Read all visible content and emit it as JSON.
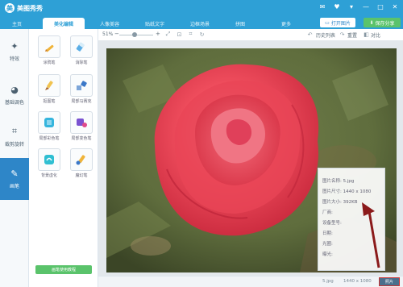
{
  "app": {
    "title": "美图秀秀"
  },
  "tabs": [
    {
      "label": "主页"
    },
    {
      "label": "美化编辑"
    },
    {
      "label": "人像美容"
    },
    {
      "label": "贴纸文字"
    },
    {
      "label": "边框场景"
    },
    {
      "label": "拼图"
    },
    {
      "label": "更多"
    }
  ],
  "actions": {
    "open": "打开图片",
    "share": "保存分享"
  },
  "sidebar": [
    {
      "label": "特效"
    },
    {
      "label": "基础调色"
    },
    {
      "label": "裁剪旋转"
    },
    {
      "label": "画笔"
    }
  ],
  "tools": [
    {
      "label": "涂鸦笔"
    },
    {
      "label": "消除笔"
    },
    {
      "label": "抠图笔"
    },
    {
      "label": "局部马赛克"
    },
    {
      "label": "局部彩色笔"
    },
    {
      "label": "局部变色笔"
    },
    {
      "label": "背景虚化"
    },
    {
      "label": "魔幻笔"
    }
  ],
  "tutorial": "画笔使用教程",
  "toolbar": {
    "zoom": "51%",
    "minus": "−",
    "plus": "+",
    "history": "历史列表",
    "reset": "重置",
    "compare": "对比"
  },
  "info": {
    "name": "图片名称: 5.jpg",
    "dimensions": "图片尺寸: 1440 x 1080",
    "size": "图片大小: 392KB",
    "maker": "厂商:",
    "model": "设备型号:",
    "date": "日期:",
    "aperture": "光圈:",
    "exposure": "曝光:"
  },
  "status": {
    "filename": "5.jpg",
    "dims": "1440 x 1080",
    "button": "照片"
  },
  "colors": {
    "accent": "#2ea0d6",
    "green": "#5ac36b",
    "active_side": "#2e86c8",
    "arrow": "#8b1a1a"
  }
}
